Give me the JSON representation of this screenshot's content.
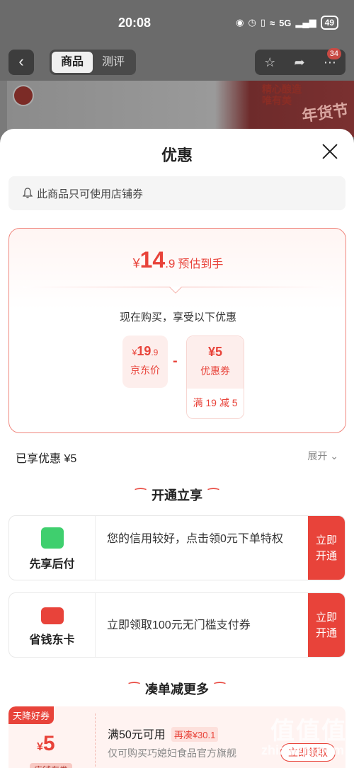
{
  "status_bar": {
    "time": "20:08",
    "network": "5G",
    "battery": "49"
  },
  "nav": {
    "back_icon": "back-chevron",
    "tabs": [
      {
        "label": "商品",
        "active": true
      },
      {
        "label": "测评",
        "active": false
      }
    ],
    "badge": "34"
  },
  "banner": {
    "slogan_line1": "精心酿造",
    "slogan_line2": "唯有美",
    "festival": "年货节"
  },
  "sheet": {
    "title": "优惠",
    "notice": "此商品只可使用店铺券",
    "estimate": {
      "currency": "¥",
      "integer": "14",
      "decimal": ".9",
      "label": "预估到手"
    },
    "subtitle": "现在购买，享受以下优惠",
    "jd_price": {
      "currency": "¥",
      "integer": "19",
      "decimal": ".9",
      "label": "京东价"
    },
    "operator": "-",
    "coupon_price": {
      "value": "¥5",
      "label": "优惠券",
      "condition": "满 19 减 5"
    },
    "enjoyed": "已享优惠 ¥5",
    "expand": "展开",
    "section_open": "开通立享",
    "services": [
      {
        "name": "先享后付",
        "desc": "您的信用较好，点击领0元下单特权",
        "action": "立即开通",
        "icon": "shopping-bag-icon",
        "color": "#3fcf6e"
      },
      {
        "name": "省钱东卡",
        "desc": "立即领取100元无门槛支付券",
        "action": "立即开通",
        "icon": "card-icon",
        "color": "#e8433a"
      }
    ],
    "section_more": "凑单减更多",
    "coupon": {
      "tag": "天降好券",
      "currency": "¥",
      "amount": "5",
      "type": "店铺东券",
      "title": "满50元可用",
      "extra": "再凑¥30.1",
      "shop": "仅可购买巧媳妇食品官方旗舰",
      "claim": "立即领取"
    }
  },
  "watermark": {
    "text": "值值值",
    "site": "zhizhizhi.com"
  }
}
